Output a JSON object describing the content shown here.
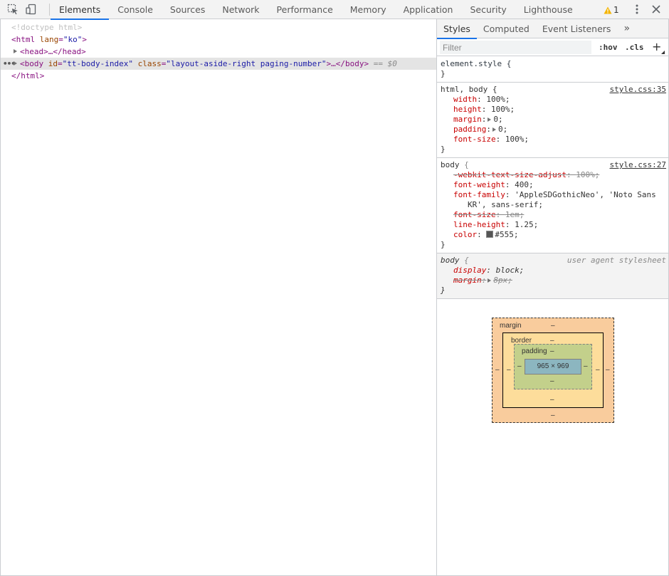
{
  "toolbar": {
    "tabs": [
      "Elements",
      "Console",
      "Sources",
      "Network",
      "Performance",
      "Memory",
      "Application",
      "Security",
      "Lighthouse"
    ],
    "active_tab": "Elements",
    "warning_count": "1"
  },
  "dom": {
    "doctype": "<!doctype html>",
    "html_open_tag": "<html",
    "html_lang_attr": "lang",
    "html_lang_val": "\"ko\"",
    "html_open_close": ">",
    "head_open": "<head>",
    "head_ellipsis": "…",
    "head_close": "</head>",
    "body_open_tag": "<body",
    "body_id_attr": "id",
    "body_id_val": "\"tt-body-index\"",
    "body_class_attr": "class",
    "body_class_val": "\"layout-aside-right paging-number\"",
    "body_close_part": ">…</body>",
    "selected_marker": "== $0",
    "html_close": "</html>",
    "gutter_ellipsis": "•••"
  },
  "sidebar": {
    "tabs": [
      "Styles",
      "Computed",
      "Event Listeners"
    ],
    "active_tab": "Styles",
    "more": "»",
    "filter_placeholder": "Filter",
    "hov": ":hov",
    "cls": ".cls",
    "plus": "+"
  },
  "rules": {
    "element_style": {
      "selector": "element.style {",
      "close": "}"
    },
    "html_body": {
      "selector": "html, body",
      "source": "style.css:35",
      "decls": [
        {
          "prop": "width",
          "val": "100%;"
        },
        {
          "prop": "height",
          "val": "100%;"
        },
        {
          "prop": "margin",
          "val": "0;"
        },
        {
          "prop": "padding",
          "val": "0;"
        },
        {
          "prop": "font-size",
          "val": "100%;"
        }
      ]
    },
    "body": {
      "selector": "body",
      "source": "style.css:27",
      "webkit": {
        "prop": "-webkit-text-size-adjust",
        "val": "100%;"
      },
      "font_weight": {
        "prop": "font-weight",
        "val": "400;"
      },
      "font_family": {
        "prop": "font-family",
        "val1": "'AppleSDGothicNeo', 'Noto Sans",
        "val2": "KR', sans-serif;"
      },
      "font_size": {
        "prop": "font-size",
        "val": "1em;"
      },
      "line_height": {
        "prop": "line-height",
        "val": "1.25;"
      },
      "color": {
        "prop": "color",
        "val": "#555;"
      }
    },
    "ua": {
      "selector": "body",
      "source": "user agent stylesheet",
      "display": {
        "prop": "display",
        "val": "block;"
      },
      "margin": {
        "prop": "margin",
        "val": "8px;"
      }
    }
  },
  "box_model": {
    "margin_label": "margin",
    "border_label": "border",
    "padding_label": "padding",
    "dash": "–",
    "content_size": "965 × 969"
  },
  "colors": {
    "accent": "#1a73e8",
    "swatch": "#555555",
    "warning": "#f4b400"
  }
}
